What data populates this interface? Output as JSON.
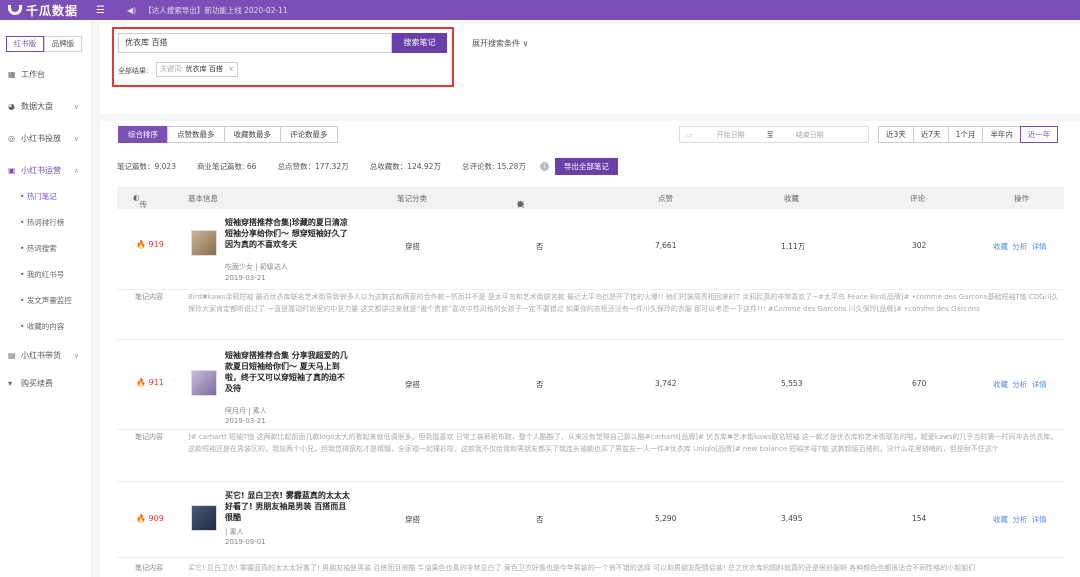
{
  "topbar": {
    "brand": "千瓜数据",
    "notice": "【达人搜索导出】新功能上线 2020-02-11"
  },
  "sidebar": {
    "versions": [
      "红书版",
      "品牌版"
    ],
    "items": [
      {
        "label": "工作台"
      },
      {
        "label": "数据大盘"
      },
      {
        "label": "小红书投放"
      },
      {
        "label": "小红书运营"
      },
      {
        "label": "小红书带货"
      },
      {
        "label": "购买续费"
      }
    ],
    "subitems": [
      "热门笔记",
      "热词排行榜",
      "热词搜索",
      "我的红书号",
      "发文声量监控",
      "收藏的内容"
    ]
  },
  "search": {
    "query": "优衣库 百搭",
    "button": "搜索笔记",
    "expand": "展开搜索条件",
    "all_results_label": "全部结果:",
    "tag_key": "关键词:",
    "tag_value": "优衣库 百搭"
  },
  "sort_tabs": [
    "综合排序",
    "点赞数最多",
    "收藏数最多",
    "评论数最多"
  ],
  "date_filter": {
    "start": "开始日期",
    "to": "至",
    "end": "结束日期"
  },
  "range_tabs": [
    "近3天",
    "近7天",
    "1个月",
    "半年内",
    "近一年"
  ],
  "stats": {
    "notes": "笔记篇数：9,023",
    "commercial": "商业笔记篇数: 66",
    "likes": "总点赞数：177.32万",
    "favs": "总收藏数：124.92万",
    "comments": "总评论数: 15.28万",
    "export": "导出全部笔记"
  },
  "table": {
    "headers": {
      "spread": "传播指数",
      "basic": "基本信息",
      "category": "笔记分类",
      "commercial": "商业笔记",
      "likes": "点赞",
      "favs": "收藏",
      "comments": "评论",
      "ops": "操作"
    },
    "note_label": "笔记内容",
    "ops_label": "收藏 分析 详情",
    "rows": [
      {
        "heat": "919",
        "title": "短袖穿搭推荐合集|珍藏的夏日清凉短袖分享给你们～ 想穿短袖好久了因为真的不喜欢冬天",
        "author": "吃面少女 | 初级达人",
        "date": "2019-03-21",
        "category": "穿搭",
        "commercial": "否",
        "likes": "7,661",
        "favs": "1.11万",
        "comments": "302",
        "content": "Bird✖kaws涂鸦短袖 最近优衣库联名艺术街导致很多人以为这款式和两家的合作款~然而并不是 是太平鸟和艺术街联名款 最近太平鸟也是开了挂的火爆!! 他们时装周亮相回来的T 涂鸦民真的非常喜欢了~#太平鸟 Peace Bird[品牌]# •comme des Garcons基础短袖T恤 CDG川久保玲大家肯定都听说过了 一直是靠动时尚里的中坚力量 这文都讲过来就是“傲个贵族”喜欢中性风格的女孩子一定不要错过 如果你的衣柜还没有一件川久保玲的衣服 那可以考虑一下这件!!! #Comme des Garcons 川久保玲[品牌]# •comme des Garcons"
      },
      {
        "heat": "911",
        "title": "短袖穿搭推荐合集 分享我超爱的几款夏日短袖给你们～ 夏天马上到啦，终于又可以穿短袖了真的迫不及待",
        "author": "阿月月 | 素人",
        "date": "2019-03-21",
        "category": "穿搭",
        "commercial": "否",
        "likes": "3,742",
        "favs": "5,553",
        "comments": "670",
        "content": "]# carhartt 短袖T恤 这两款比起前面几款logo太大的看起来就低调很多，但我挺喜欢 日常工装裤帆布鞋，整个人酷酷了，从来没有觉得自己那么酷#carhartt[品牌]# 优衣库✖艺术街kaws联名短袖 这一款才是优衣库和艺术街联名的啦，超爱kaws的几乎当时第一时间冲去优衣库。这款短袖还是在男装区的，我前两个小兄，但我觉得宽松才是精髓，全家福一起撞衫啦，这款我不仅给我和男朋友都买了我连长袖款也买了男盆友一人一件#优衣库 Uniqlo[品牌]# new balance 短袖字母T恤 这款超级百搭的，没什么花里胡哨的，但是耐不住这个"
      },
      {
        "heat": "909",
        "title": "买它! 显白卫衣! 雾霾蓝真的太太太好看了! 男朋友袖是男装 百搭而且很酷",
        "author": "| 素人",
        "date": "2019-09-01",
        "category": "穿搭",
        "commercial": "否",
        "likes": "5,290",
        "favs": "3,495",
        "comments": "154",
        "content": "买它! 显白卫衣! 雾霾蓝真的太太太好看了! 男朋友袖是男装 百搭而且很酷 牛油果色也真的非常显白了 黄色卫衣好像也是今年男装的一个很不错的选择 可以和男朋友配情侣装! 总之优衣库的圆料就真的还是很舒服啊 各种颜色也都很适合不同性格的小姐姐们"
      }
    ]
  }
}
